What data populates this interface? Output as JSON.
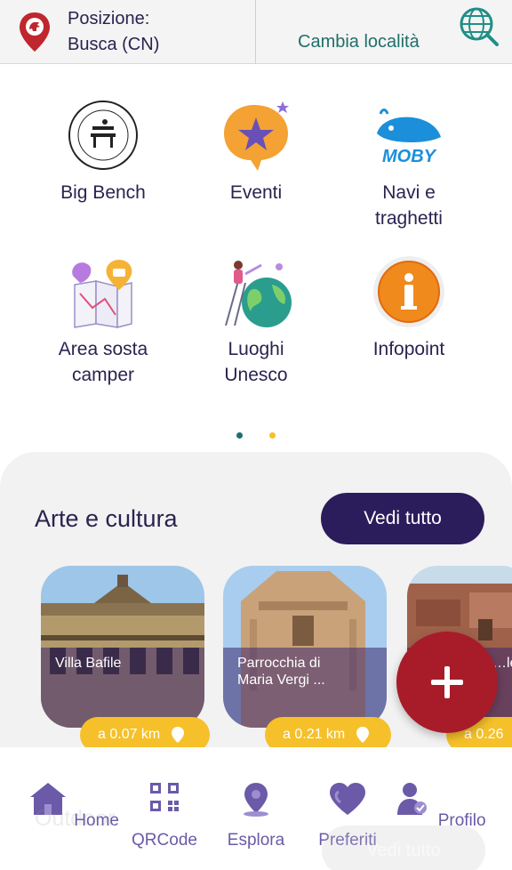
{
  "header": {
    "position_label": "Posizione:",
    "position_value": "Busca (CN)",
    "change_location": "Cambia località"
  },
  "categories": [
    {
      "label": "Big Bench",
      "icon": "big-bench-logo"
    },
    {
      "label": "Eventi",
      "icon": "star-bubble-icon"
    },
    {
      "label": "Navi e traghetti",
      "icon": "moby-whale-logo"
    },
    {
      "label": "Area sosta camper",
      "icon": "camper-map-icon"
    },
    {
      "label": "Luoghi Unesco",
      "icon": "globe-people-icon"
    },
    {
      "label": "Infopoint",
      "icon": "info-icon"
    }
  ],
  "carousel": {
    "pages": 2,
    "active": 1
  },
  "section": {
    "title": "Arte e cultura",
    "vedi_tutto": "Vedi tutto",
    "cards": [
      {
        "name": "Villa Bafile",
        "distance": "a 0.07 km"
      },
      {
        "name": "Parrocchia di Maria Vergi ...",
        "distance": "a 0.21 km"
      },
      {
        "name": "…le",
        "distance": "a 0.26"
      }
    ]
  },
  "fab": {
    "icon": "plus-icon"
  },
  "nav": [
    {
      "label": "Home",
      "icon": "home-icon"
    },
    {
      "label": "QRCode",
      "icon": "qrcode-icon"
    },
    {
      "label": "Esplora",
      "icon": "map-pin-icon"
    },
    {
      "label": "Preferiti",
      "icon": "heart-icon"
    },
    {
      "label": "Profilo",
      "icon": "user-icon"
    }
  ],
  "behind_nav": {
    "section_title": "Outdoor",
    "button": "Vedi tutto"
  },
  "colors": {
    "primary": "#2b1d5c",
    "accent_teal": "#1f6f6a",
    "badge_yellow": "#f5c02a",
    "fab_red": "#a81c2a",
    "nav_purple": "#6b5aa8",
    "brand_red": "#c0262d"
  }
}
